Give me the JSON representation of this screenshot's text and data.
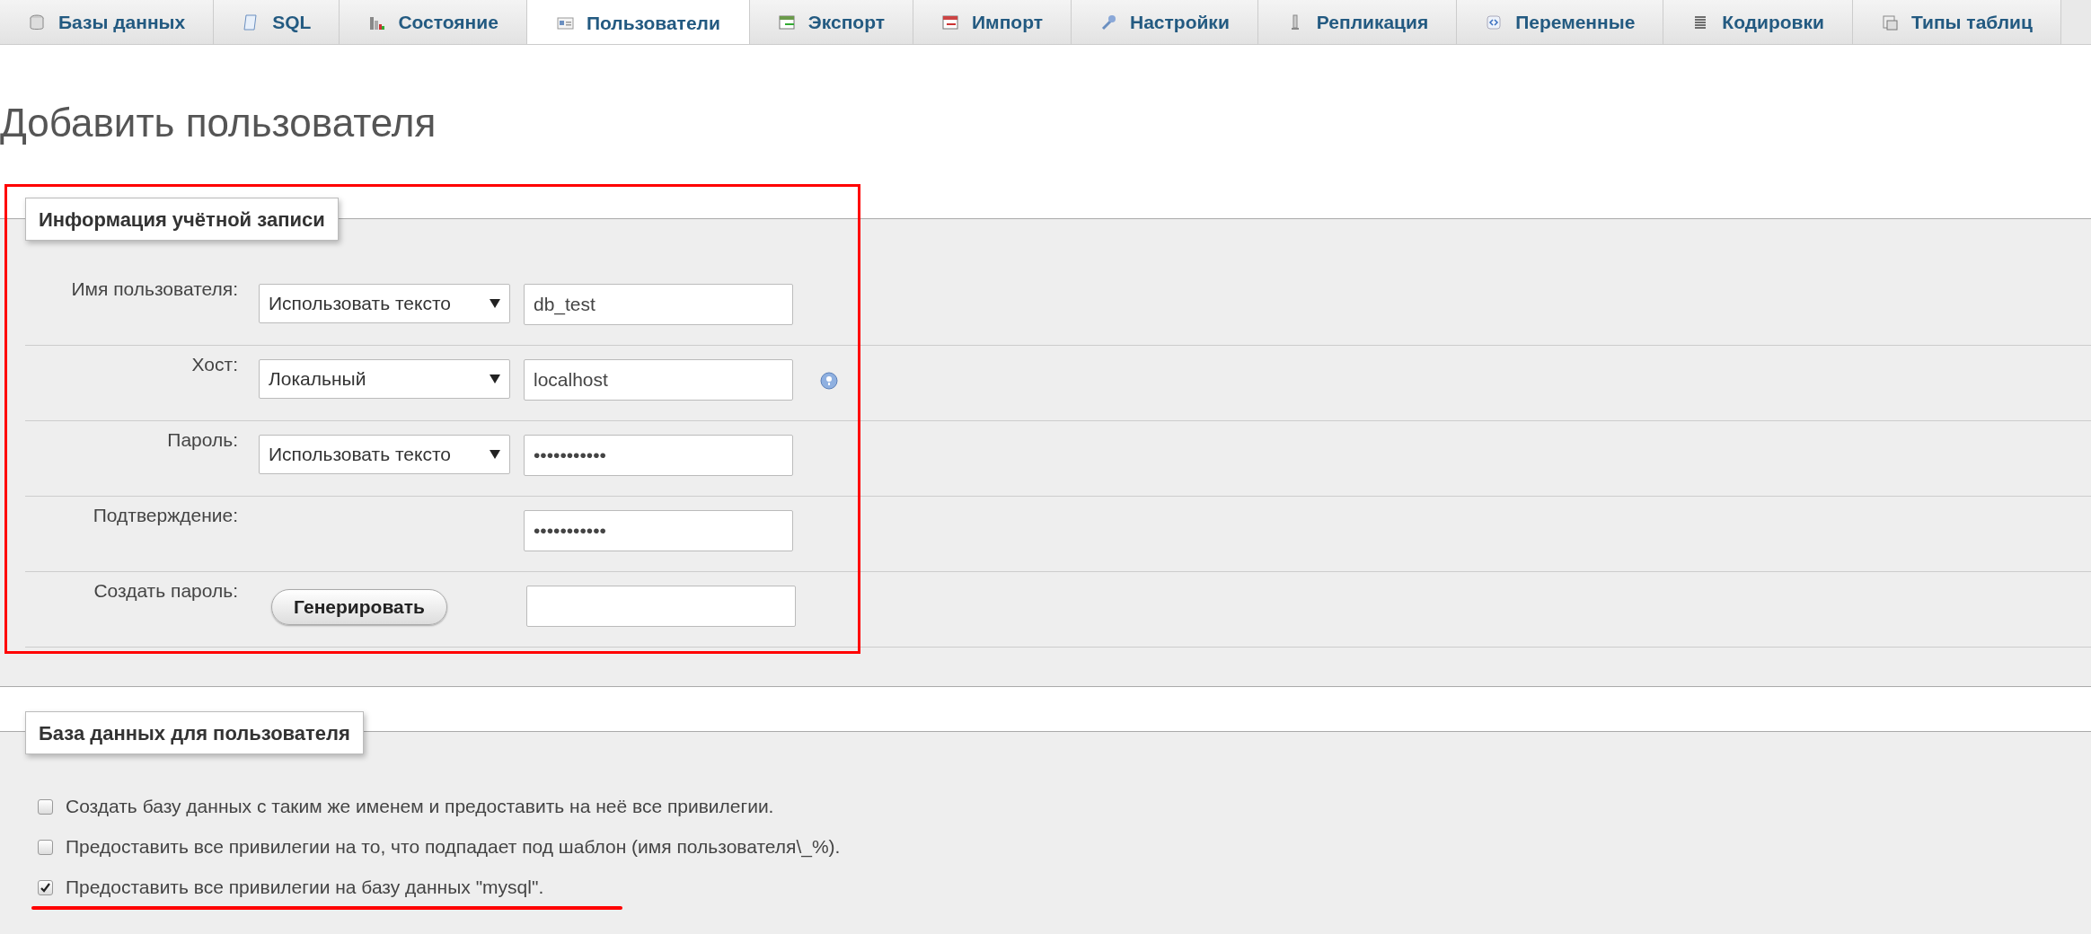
{
  "tabs": [
    {
      "label": "Базы данных",
      "selected": false
    },
    {
      "label": "SQL",
      "selected": false
    },
    {
      "label": "Состояние",
      "selected": false
    },
    {
      "label": "Пользователи",
      "selected": true
    },
    {
      "label": "Экспорт",
      "selected": false
    },
    {
      "label": "Импорт",
      "selected": false
    },
    {
      "label": "Настройки",
      "selected": false
    },
    {
      "label": "Репликация",
      "selected": false
    },
    {
      "label": "Переменные",
      "selected": false
    },
    {
      "label": "Кодировки",
      "selected": false
    },
    {
      "label": "Типы таблиц",
      "selected": false
    }
  ],
  "page_title": "Добавить пользователя",
  "account": {
    "legend": "Информация учётной записи",
    "rows": [
      {
        "kind": "select",
        "label": "Имя пользователя:",
        "select": "Использовать тексто",
        "value": "db_test",
        "help": false
      },
      {
        "kind": "select",
        "label": "Хост:",
        "select": "Локальный",
        "value": "localhost",
        "help": true
      },
      {
        "kind": "select",
        "label": "Пароль:",
        "select": "Использовать тексто",
        "value": "•••••••••••",
        "help": false
      },
      {
        "kind": "plain",
        "label": "Подтверждение:",
        "value": "•••••••••••",
        "help": false
      },
      {
        "kind": "button",
        "label": "Создать пароль:",
        "button": "Генерировать",
        "help": false
      }
    ]
  },
  "database": {
    "legend": "База данных для пользователя",
    "options": [
      {
        "label": "Создать базу данных с таким же именем и предоставить на неё все привилегии.",
        "checked": false,
        "underlined": false
      },
      {
        "label": "Предоставить все привилегии на то, что подпадает под шаблон (имя пользователя\\_%).",
        "checked": false,
        "underlined": false
      },
      {
        "label": "Предоставить все привилегии на базу данных \"mysql\".",
        "checked": true,
        "underlined": true
      }
    ]
  },
  "annotation_frame": true
}
